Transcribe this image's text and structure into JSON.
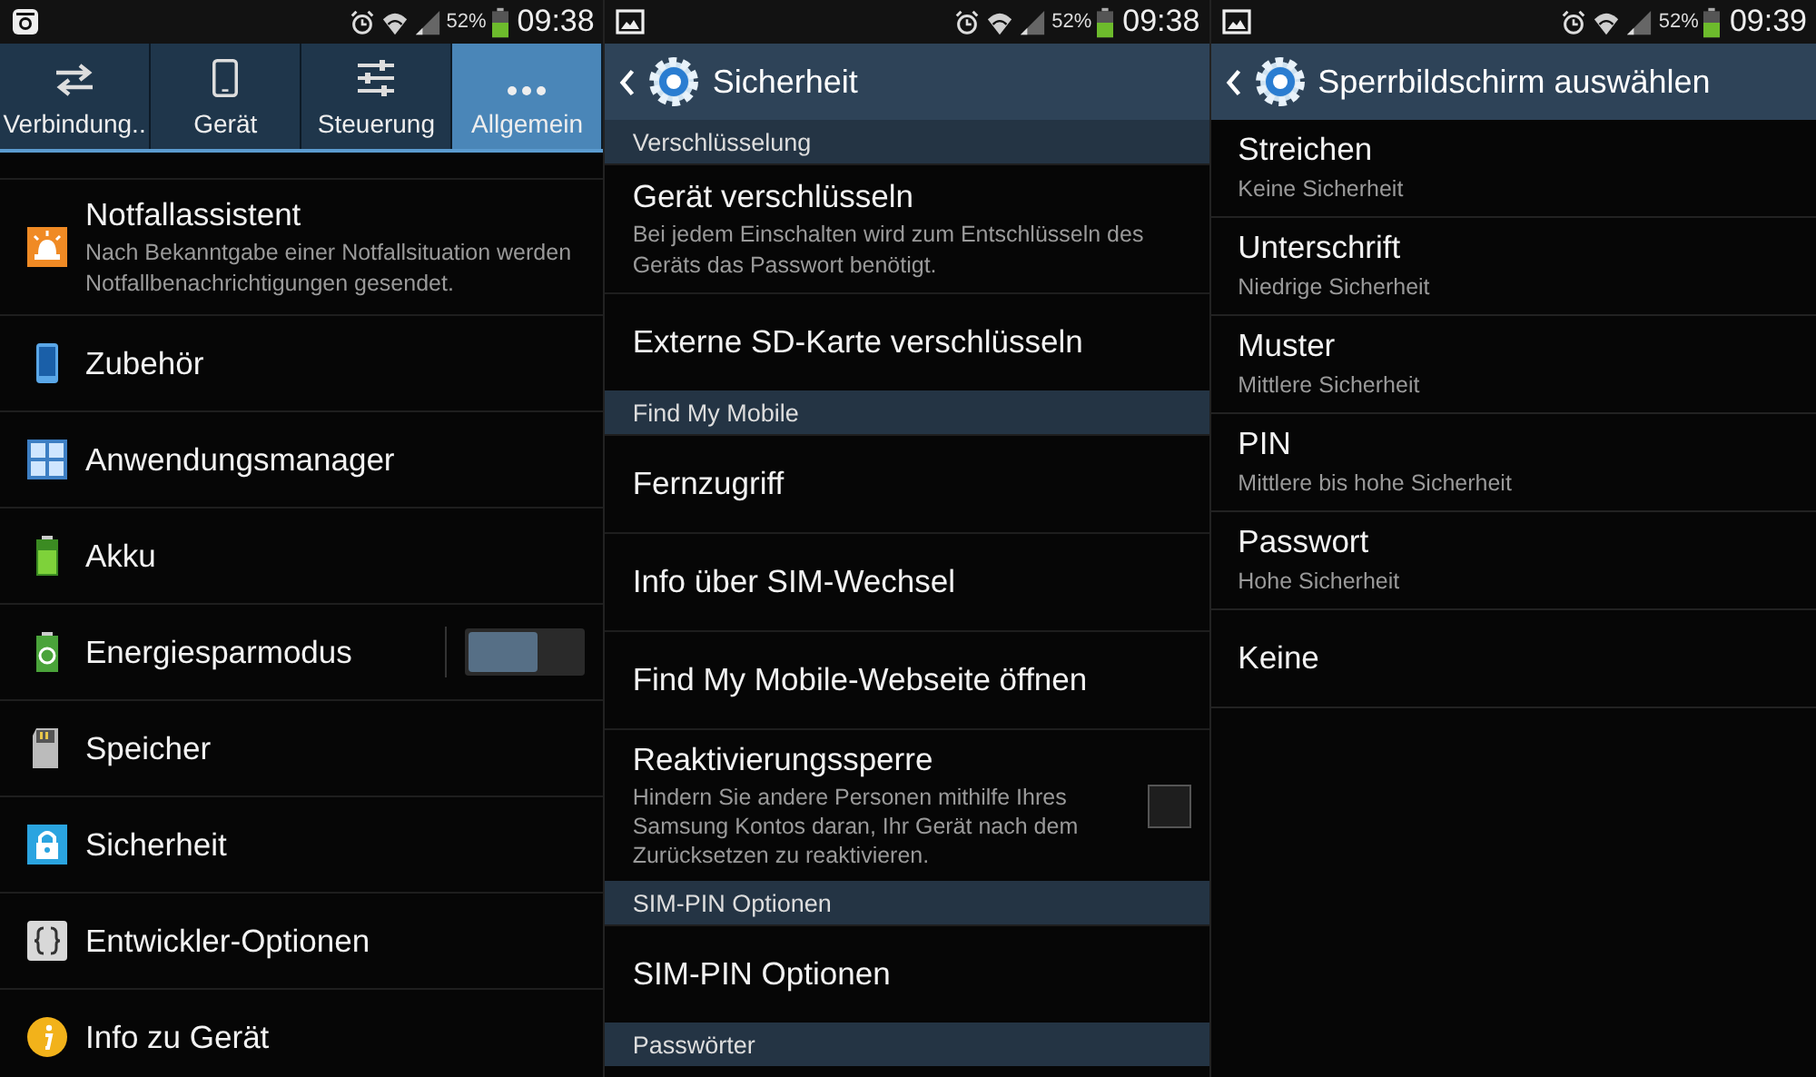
{
  "screens": [
    {
      "status_bar": {
        "battery": "52%",
        "time": "09:38"
      },
      "tabs": [
        {
          "label": "Verbindung..",
          "selected": false
        },
        {
          "label": "Gerät",
          "selected": false
        },
        {
          "label": "Steuerung",
          "selected": false
        },
        {
          "label": "Allgemein",
          "selected": true
        }
      ],
      "items": [
        {
          "kind": "plain",
          "title": "Notfallassistent",
          "subtitle": "Nach Bekanntgabe einer Notfallsituation werden Notfallbenachrichtigungen gesendet."
        },
        {
          "kind": "plain",
          "title": "Zubehör"
        },
        {
          "kind": "plain",
          "title": "Anwendungsmanager"
        },
        {
          "kind": "plain",
          "title": "Akku"
        },
        {
          "kind": "toggle",
          "title": "Energiesparmodus",
          "on": false
        },
        {
          "kind": "plain",
          "title": "Speicher"
        },
        {
          "kind": "plain",
          "title": "Sicherheit"
        },
        {
          "kind": "plain",
          "title": "Entwickler-Optionen"
        },
        {
          "kind": "plain",
          "title": "Info zu Gerät"
        }
      ]
    },
    {
      "status_bar": {
        "battery": "52%",
        "time": "09:38"
      },
      "title": "Sicherheit",
      "items": [
        {
          "kind": "section",
          "title": "Verschlüsselung"
        },
        {
          "kind": "item",
          "title": "Gerät verschlüsseln",
          "subtitle": "Bei jedem Einschalten wird zum Entschlüsseln des Geräts das Passwort benötigt."
        },
        {
          "kind": "item",
          "title": "Externe SD-Karte verschlüsseln"
        },
        {
          "kind": "section",
          "title": "Find My Mobile"
        },
        {
          "kind": "item",
          "title": "Fernzugriff"
        },
        {
          "kind": "item",
          "title": "Info über SIM-Wechsel"
        },
        {
          "kind": "item",
          "title": "Find My Mobile-Webseite öffnen"
        },
        {
          "kind": "checkbox",
          "title": "Reaktivierungssperre",
          "subtitle": "Hindern Sie andere Personen mithilfe Ihres Samsung Kontos daran, Ihr Gerät nach dem Zurücksetzen zu reaktivieren.",
          "checked": false
        },
        {
          "kind": "section",
          "title": "SIM-PIN Optionen"
        },
        {
          "kind": "item",
          "title": "SIM-PIN Optionen"
        },
        {
          "kind": "section",
          "title": "Passwörter"
        }
      ]
    },
    {
      "status_bar": {
        "battery": "52%",
        "time": "09:39"
      },
      "title": "Sperrbildschirm auswählen",
      "items": [
        {
          "title": "Streichen",
          "subtitle": "Keine Sicherheit"
        },
        {
          "title": "Unterschrift",
          "subtitle": "Niedrige Sicherheit"
        },
        {
          "title": "Muster",
          "subtitle": "Mittlere Sicherheit"
        },
        {
          "title": "PIN",
          "subtitle": "Mittlere bis hohe Sicherheit"
        },
        {
          "title": "Passwort",
          "subtitle": "Hohe Sicherheit"
        },
        {
          "title": "Keine"
        }
      ]
    }
  ]
}
